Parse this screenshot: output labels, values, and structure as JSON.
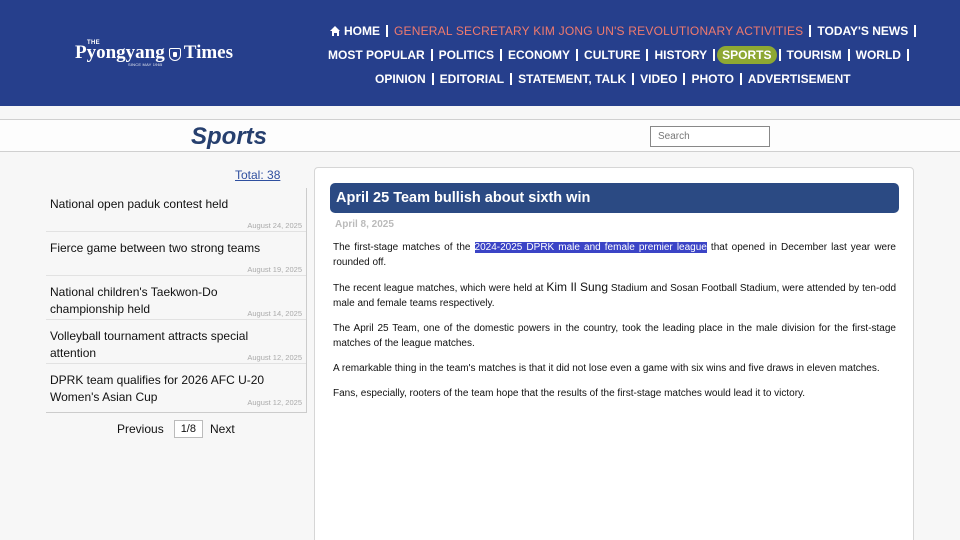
{
  "brand": {
    "the": "THE",
    "name_left": "Pyongyang",
    "name_right": "Times",
    "tagline": "SINCE MAY 1965"
  },
  "nav": {
    "row1": [
      {
        "label": "HOME",
        "icon": "home-icon"
      },
      {
        "label": "GENERAL SECRETARY KIM JONG UN'S REVOLUTIONARY ACTIVITIES",
        "color": "#f07a6e"
      },
      {
        "label": "TODAY'S NEWS"
      }
    ],
    "row2": [
      {
        "label": "MOST POPULAR"
      },
      {
        "label": "POLITICS"
      },
      {
        "label": "ECONOMY"
      },
      {
        "label": "CULTURE"
      },
      {
        "label": "HISTORY"
      },
      {
        "label": "SPORTS",
        "active": true
      },
      {
        "label": "TOURISM"
      },
      {
        "label": "WORLD"
      }
    ],
    "row3": [
      {
        "label": "OPINION"
      },
      {
        "label": "EDITORIAL"
      },
      {
        "label": "STATEMENT, TALK"
      },
      {
        "label": "VIDEO"
      },
      {
        "label": "PHOTO"
      },
      {
        "label": "ADVERTISEMENT"
      }
    ]
  },
  "page": {
    "title": "Sports",
    "search_placeholder": "Search"
  },
  "list": {
    "total": "Total: 38",
    "items": [
      {
        "title": "National open paduk contest held",
        "date": "August 24, 2025"
      },
      {
        "title": "Fierce game between two strong teams",
        "date": "August 19, 2025"
      },
      {
        "title": "National children's Taekwon-Do championship held",
        "date": "August 14, 2025"
      },
      {
        "title": "Volleyball tournament attracts special attention",
        "date": "August 12, 2025"
      },
      {
        "title": "DPRK team qualifies for 2026 AFC U-20 Women's Asian Cup",
        "date": "August 12, 2025"
      }
    ],
    "pager": {
      "previous": "Previous",
      "page": "1/8",
      "next": "Next"
    }
  },
  "article": {
    "headline": "April 25 Team bullish about sixth win",
    "date": "April 8, 2025",
    "p1_before": "The first-stage matches of the ",
    "p1_highlight": "2024-2025 DPRK male and female premier league",
    "p1_after": " that opened in December last year were rounded off.",
    "p2_before": "The recent league matches, which were held at ",
    "p2_kim": "Kim Il Sung",
    "p2_after": " Stadium and Sosan Football Stadium, were attended by ten-odd male and female teams respectively.",
    "p3": "The April 25 Team, one of the domestic powers in the country,  took the leading place in the male division for the first-stage matches of the league matches.",
    "p4": "A remarkable thing in the team's matches is that it did not lose even a game with six wins and five draws in eleven matches.",
    "p5": "Fans, especially, rooters of the team hope that the results of the first-stage matches would lead it to victory."
  },
  "colors": {
    "header_bg": "#263f8c",
    "active_tab": "#8ea833",
    "highlight": "#3b44c6",
    "headline_bg": "#2b4a83"
  }
}
